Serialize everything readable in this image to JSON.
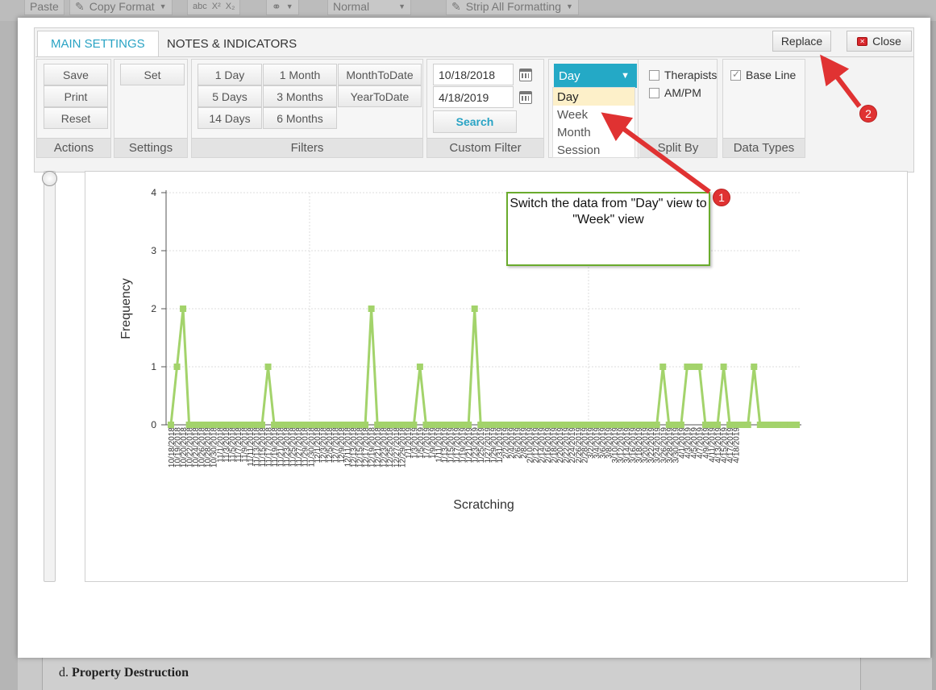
{
  "background": {
    "toolbar": {
      "paste": "Paste",
      "copy_format": "Copy Format",
      "style": "Normal",
      "strip": "Strip All Formatting"
    },
    "doc_prefix": "d.",
    "doc_heading": "Property Destruction"
  },
  "tabs": [
    "MAIN SETTINGS",
    "NOTES & INDICATORS"
  ],
  "replace_label": "Replace",
  "close_label": "Close",
  "actions": {
    "label": "Actions",
    "buttons": [
      "Save",
      "Print",
      "Reset"
    ]
  },
  "settings": {
    "label": "Settings",
    "button": "Set"
  },
  "filters": {
    "label": "Filters",
    "buttons": [
      "1 Day",
      "1 Month",
      "MonthToDate",
      "5 Days",
      "3 Months",
      "YearToDate",
      "14 Days",
      "6 Months"
    ]
  },
  "custom_filter": {
    "label": "Custom Filter",
    "start": "10/18/2018",
    "end": "4/18/2019",
    "search": "Search"
  },
  "split_by": {
    "label": "Split By",
    "selected": "Day",
    "options": [
      "Day",
      "Week",
      "Month",
      "Session"
    ],
    "therapists": "Therapists",
    "ampm": "AM/PM"
  },
  "data_types": {
    "label": "Data Types",
    "baseline": "Base Line",
    "baseline_checked": true
  },
  "callout": "Switch the data from \"Day\" view to \"Week\" view",
  "badges": [
    "1",
    "2"
  ],
  "colors": {
    "accent": "#24a9c6",
    "series": "#a3d36b",
    "callout_border": "#6aab2d",
    "annotation": "#e03232"
  },
  "chart_data": {
    "type": "line",
    "xlabel": "Scratching",
    "ylabel": "Frequency",
    "ylim": [
      0,
      4
    ],
    "yticks": [
      0,
      1,
      2,
      3,
      4
    ],
    "categories": [
      "10/18/2018",
      "10/19/2018",
      "10/20/2018",
      "10/22/2018",
      "10/24/2018",
      "10/26/2018",
      "10/28/2018",
      "10/30/2018",
      "11/1/2018",
      "11/3/2018",
      "11/5/2018",
      "11/7/2018",
      "11/9/2018",
      "11/11/2018",
      "11/13/2018",
      "11/15/2018",
      "11/17/2018",
      "11/19/2018",
      "11/21/2018",
      "11/23/2018",
      "11/25/2018",
      "11/27/2018",
      "11/29/2018",
      "11/30/2018",
      "12/1/2018",
      "12/3/2018",
      "12/5/2018",
      "12/7/2018",
      "12/9/2018",
      "12/11/2018",
      "12/13/2018",
      "12/15/2018",
      "12/17/2018",
      "12/19/2018",
      "12/21/2018",
      "12/23/2018",
      "12/25/2018",
      "12/27/2018",
      "12/29/2018",
      "1/1/2019",
      "1/3/2019",
      "1/5/2019",
      "1/7/2019",
      "1/9/2019",
      "1/11/2019",
      "1/13/2019",
      "1/15/2019",
      "1/17/2019",
      "1/19/2019",
      "1/21/2019",
      "1/23/2019",
      "1/25/2019",
      "1/27/2019",
      "1/29/2019",
      "1/31/2019",
      "2/2/2019",
      "2/4/2019",
      "2/6/2019",
      "2/8/2019",
      "2/10/2019",
      "2/12/2019",
      "2/14/2019",
      "2/16/2019",
      "2/18/2019",
      "2/20/2019",
      "2/22/2019",
      "2/24/2019",
      "2/26/2019",
      "2/28/2019",
      "3/2/2019",
      "3/4/2019",
      "3/6/2019",
      "3/8/2019",
      "3/10/2019",
      "3/12/2019",
      "3/14/2019",
      "3/16/2019",
      "3/18/2019",
      "3/20/2019",
      "3/22/2019",
      "3/24/2019",
      "3/26/2019",
      "3/28/2019",
      "3/30/2019",
      "4/1/2019",
      "4/3/2019",
      "4/5/2019",
      "4/7/2019",
      "4/9/2019",
      "4/11/2019",
      "4/13/2019",
      "4/15/2019",
      "4/17/2019",
      "4/18/2019"
    ],
    "series": [
      {
        "values": [
          0,
          1,
          2,
          0,
          0,
          0,
          0,
          0,
          0,
          0,
          0,
          0,
          0,
          0,
          0,
          0,
          1,
          0,
          0,
          0,
          0,
          0,
          0,
          0,
          0,
          0,
          0,
          0,
          0,
          0,
          0,
          0,
          0,
          2,
          0,
          0,
          0,
          0,
          0,
          0,
          0,
          1,
          0,
          0,
          0,
          0,
          0,
          0,
          0,
          0,
          2,
          0,
          0,
          0,
          0,
          0,
          0,
          0,
          0,
          0,
          0,
          0,
          0,
          0,
          0,
          0,
          0,
          0,
          0,
          0,
          0,
          0,
          0,
          0,
          0,
          0,
          0,
          0,
          0,
          0,
          0,
          1,
          0,
          0,
          0,
          1,
          1,
          1,
          0,
          0,
          0,
          1,
          0,
          0,
          0,
          0,
          1,
          0,
          0,
          0,
          0,
          0,
          0,
          0
        ]
      }
    ]
  }
}
